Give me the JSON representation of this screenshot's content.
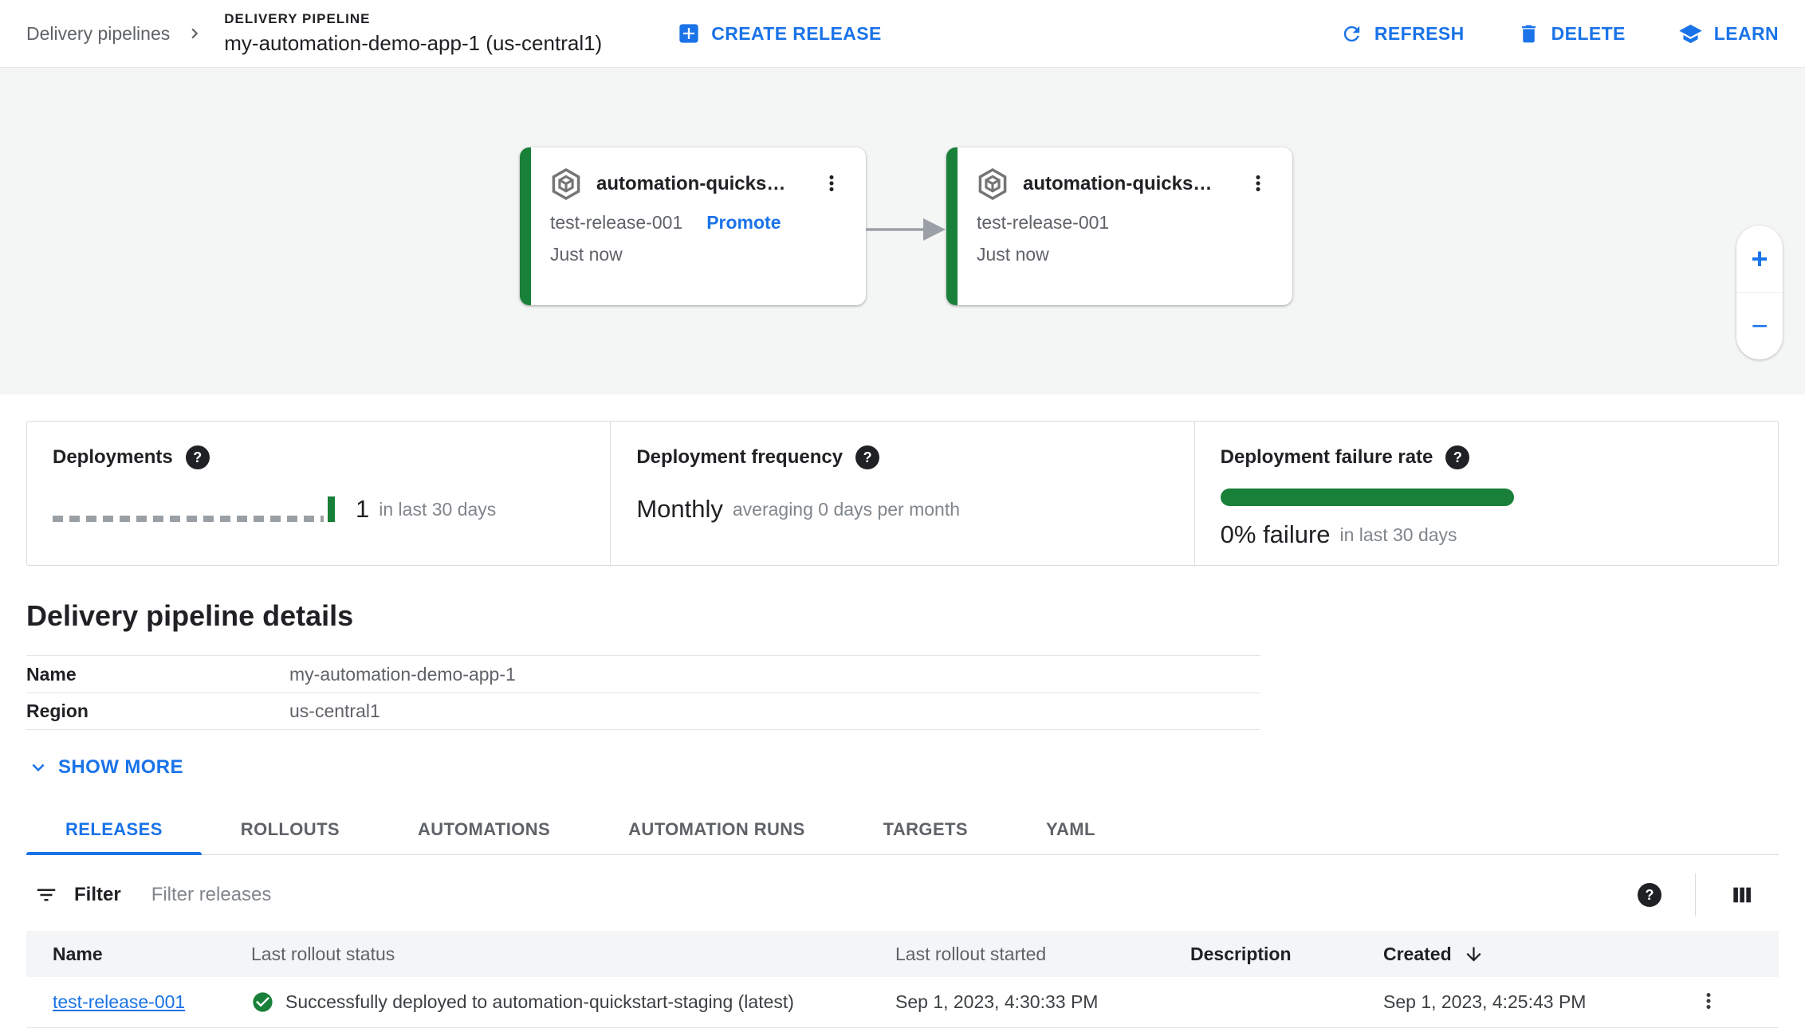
{
  "header": {
    "breadcrumb": "Delivery pipelines",
    "overline": "DELIVERY PIPELINE",
    "title": "my-automation-demo-app-1 (us-central1)",
    "actions": {
      "create_release": "CREATE RELEASE",
      "refresh": "REFRESH",
      "delete": "DELETE",
      "learn": "LEARN"
    }
  },
  "pipeline_graph": {
    "cards": [
      {
        "target": "automation-quicks…",
        "release": "test-release-001",
        "promote": "Promote",
        "time": "Just now"
      },
      {
        "target": "automation-quicks…",
        "release": "test-release-001",
        "time": "Just now"
      }
    ],
    "zoom_in": "+",
    "zoom_out": "−"
  },
  "icons": {
    "help": "?"
  },
  "metrics": {
    "deployments": {
      "label": "Deployments",
      "value": "1",
      "suffix": "in last 30 days"
    },
    "frequency": {
      "label": "Deployment frequency",
      "value": "Monthly",
      "suffix": "averaging 0 days per month"
    },
    "failure_rate": {
      "label": "Deployment failure rate",
      "value": "0% failure",
      "suffix": "in last 30 days"
    }
  },
  "details": {
    "heading": "Delivery pipeline details",
    "rows": [
      {
        "label": "Name",
        "value": "my-automation-demo-app-1"
      },
      {
        "label": "Region",
        "value": "us-central1"
      }
    ],
    "show_more": "SHOW MORE"
  },
  "tabs": [
    {
      "label": "RELEASES",
      "active": true
    },
    {
      "label": "ROLLOUTS"
    },
    {
      "label": "AUTOMATIONS"
    },
    {
      "label": "AUTOMATION RUNS"
    },
    {
      "label": "TARGETS"
    },
    {
      "label": "YAML"
    }
  ],
  "releases_table": {
    "filter_label": "Filter",
    "filter_placeholder": "Filter releases",
    "columns": [
      "Name",
      "Last rollout status",
      "Last rollout started",
      "Description",
      "Created"
    ],
    "rows": [
      {
        "name": "test-release-001",
        "status": "Successfully deployed to automation-quickstart-staging (latest)",
        "started": "Sep 1, 2023, 4:30:33 PM",
        "description": "",
        "created": "Sep 1, 2023, 4:25:43 PM"
      }
    ]
  },
  "colors": {
    "accent_blue": "#1a73e8",
    "success_green": "#188038",
    "text_dark": "#202124",
    "text_gray": "#5f6368",
    "border": "#dadce0",
    "canvas_bg": "#f4f5f5"
  }
}
